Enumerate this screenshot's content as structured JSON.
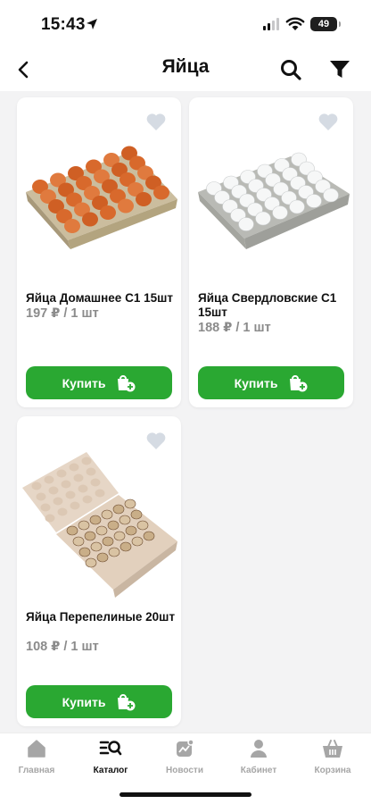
{
  "status_bar": {
    "time": "15:43",
    "battery": "49"
  },
  "header": {
    "title": "Яйца"
  },
  "colors": {
    "accent": "#2aa832",
    "muted_text": "#8b8b8b",
    "inactive_nav": "#a6a6a6"
  },
  "products": [
    {
      "name": "Яйца Домашнее С1 15шт",
      "price": "197 ₽ / 1 шт",
      "buy_label": "Купить"
    },
    {
      "name": "Яйца Свердловские С1 15шт",
      "price": "188 ₽ / 1 шт",
      "buy_label": "Купить"
    },
    {
      "name": "Яйца Перепелиные 20шт",
      "price": "108 ₽ / 1 шт",
      "buy_label": "Купить"
    }
  ],
  "bottom_nav": {
    "items": [
      {
        "label": "Главная",
        "icon": "home-icon",
        "active": false
      },
      {
        "label": "Каталог",
        "icon": "catalog-icon",
        "active": true
      },
      {
        "label": "Новости",
        "icon": "news-icon",
        "active": false
      },
      {
        "label": "Кабинет",
        "icon": "profile-icon",
        "active": false
      },
      {
        "label": "Корзина",
        "icon": "basket-icon",
        "active": false
      }
    ]
  }
}
